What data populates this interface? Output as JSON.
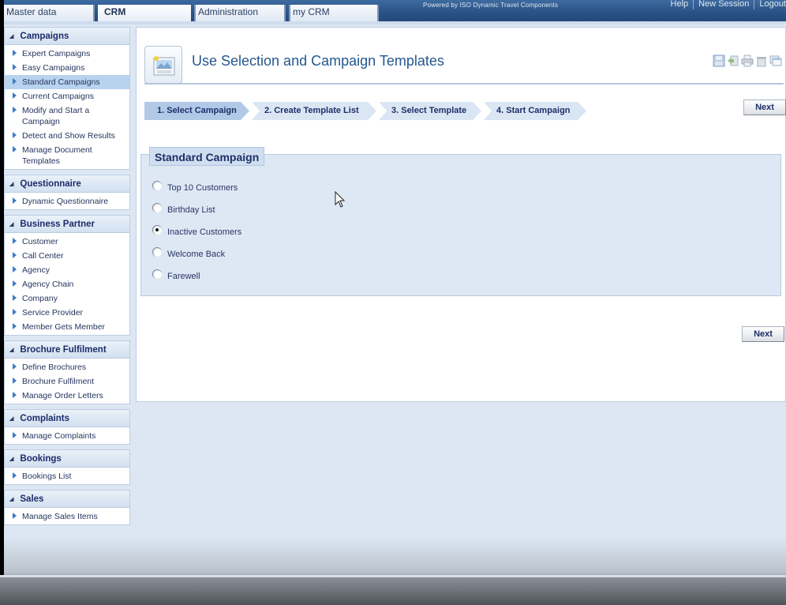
{
  "topbar": {
    "tabs": [
      {
        "label": "Master data",
        "active": false
      },
      {
        "label": "CRM",
        "active": true
      },
      {
        "label": "Administration",
        "active": false
      },
      {
        "label": "my CRM",
        "active": false
      }
    ],
    "powered_by": "Powered by ISO Dynamic Travel Components",
    "links": [
      "Help",
      "New Session",
      "Logout"
    ]
  },
  "sidebar": {
    "sections": [
      {
        "title": "Campaigns",
        "items": [
          "Expert Campaigns",
          "Easy Campaigns",
          "Standard Campaigns",
          "Current Campaigns",
          "Modify and Start a Campaign",
          "Detect and Show Results",
          "Manage Document Templates"
        ],
        "selected": "Standard Campaigns"
      },
      {
        "title": "Questionnaire",
        "items": [
          "Dynamic Questionnaire"
        ]
      },
      {
        "title": "Business Partner",
        "items": [
          "Customer",
          "Call Center",
          "Agency",
          "Agency Chain",
          "Company",
          "Service Provider",
          "Member Gets Member"
        ]
      },
      {
        "title": "Brochure Fulfilment",
        "items": [
          "Define Brochures",
          "Brochure Fulfilment",
          "Manage Order Letters"
        ]
      },
      {
        "title": "Complaints",
        "items": [
          "Manage Complaints"
        ]
      },
      {
        "title": "Bookings",
        "items": [
          "Bookings List"
        ]
      },
      {
        "title": "Sales",
        "items": [
          "Manage Sales Items"
        ]
      }
    ]
  },
  "main": {
    "title": "Use Selection and Campaign Templates",
    "toolbar_icons": [
      "save-icon",
      "export-icon",
      "print-icon",
      "delete-icon",
      "window-icon"
    ],
    "steps": [
      {
        "label": "1. Select Campaign",
        "active": true
      },
      {
        "label": "2. Create Template List",
        "active": false
      },
      {
        "label": "3. Select Template",
        "active": false
      },
      {
        "label": "4. Start Campaign",
        "active": false
      }
    ],
    "next_label": "Next",
    "group_title": "Standard Campaign",
    "options": [
      {
        "label": "Top 10 Customers",
        "checked": false
      },
      {
        "label": "Birthday List",
        "checked": false
      },
      {
        "label": "Inactive Customers",
        "checked": true
      },
      {
        "label": "Welcome Back",
        "checked": false
      },
      {
        "label": "Farewell",
        "checked": false
      }
    ]
  },
  "colors": {
    "accent": "#23588f",
    "topbar": "#2a5286",
    "selected_item": "#b8d3ee"
  }
}
